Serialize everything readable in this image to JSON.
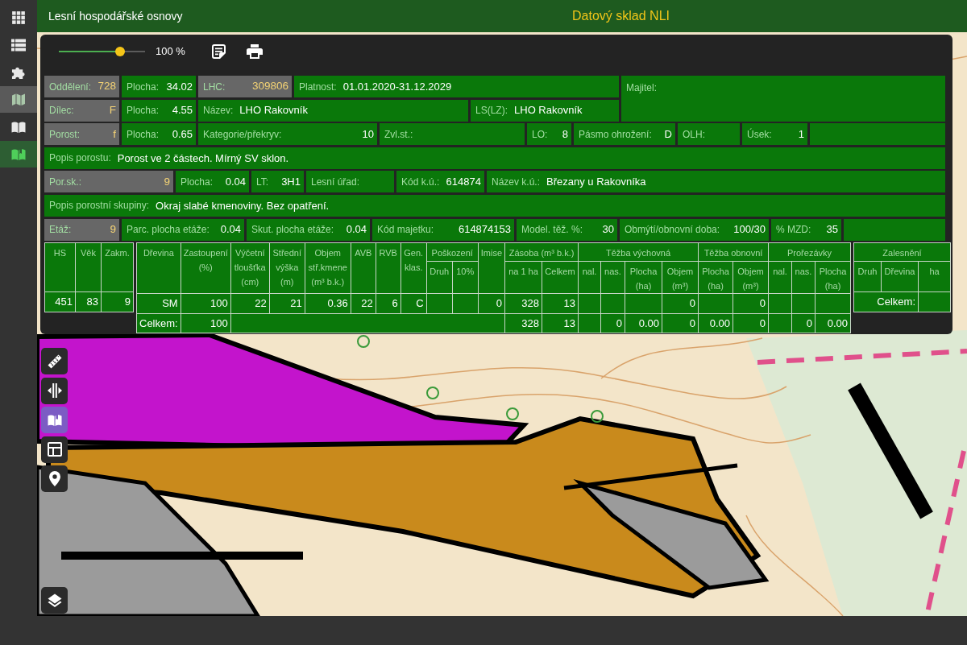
{
  "sidebar": {
    "items": [
      {
        "kind": "apps",
        "selected": false,
        "open": false
      },
      {
        "kind": "list",
        "selected": false,
        "open": false
      },
      {
        "kind": "puzzle",
        "selected": false,
        "open": false
      },
      {
        "kind": "map",
        "selected": false,
        "open": true
      },
      {
        "kind": "reader",
        "selected": false,
        "open": false
      },
      {
        "kind": "book",
        "selected": true,
        "open": false
      }
    ]
  },
  "header": {
    "title": "Lesní hospodářské osnovy",
    "app_name": "Datový sklad NLI"
  },
  "toolbar": {
    "zoom": {
      "level": 0.71,
      "reading": "100 %"
    },
    "buttons": [
      {
        "kind": "notes"
      },
      {
        "kind": "print"
      }
    ]
  },
  "info": {
    "top_lines": [
      {
        "fields": [
          {
            "kind": "key",
            "label": "Oddělení:",
            "value": "728"
          },
          {
            "kind": "number",
            "label": "Plocha:",
            "value": "34.02"
          },
          {
            "kind": "key",
            "label": "LHC:",
            "value": "309806"
          },
          {
            "kind": "text",
            "label": "Platnost:",
            "value": "01.01.2020-31.12.2029"
          }
        ]
      },
      {
        "fields": [
          {
            "kind": "key",
            "label": "Dílec:",
            "value": "F"
          },
          {
            "kind": "number",
            "label": "Plocha:",
            "value": "4.55"
          },
          {
            "kind": "text",
            "label": "Název:",
            "value": "LHO Rakovník"
          },
          {
            "kind": "text",
            "label": "LS(LZ):",
            "value": "LHO Rakovník"
          }
        ]
      }
    ],
    "owner": {
      "label": "Majitel:"
    },
    "lines": [
      {
        "fields": [
          {
            "kind": "key",
            "label": "Porost:",
            "value": "f"
          },
          {
            "kind": "number",
            "label": "Plocha:",
            "value": "0.65"
          },
          {
            "kind": "number",
            "label": "Kategorie/překryv:",
            "value": "10"
          },
          {
            "kind": "number",
            "label": "Zvl.st.:"
          },
          {
            "kind": "number",
            "label": "LO:",
            "value": "8"
          },
          {
            "kind": "number",
            "label": "Pásmo ohrožení:",
            "value": "D"
          },
          {
            "kind": "number",
            "label": "OLH:"
          },
          {
            "kind": "number",
            "label": "Úsek:",
            "value": "1"
          },
          {
            "kind": "blank"
          }
        ]
      },
      {
        "fields": [
          {
            "kind": "text",
            "label": "Popis porostu:",
            "value": "Porost ve 2 částech. Mírný SV sklon."
          }
        ]
      },
      {
        "fields": [
          {
            "kind": "key",
            "label": "Por.sk.:",
            "value": "9"
          },
          {
            "kind": "number",
            "label": "Plocha:",
            "value": "0.04"
          },
          {
            "kind": "number",
            "label": "LT:",
            "value": "3H1"
          },
          {
            "kind": "number",
            "label": "Lesní úřad:"
          },
          {
            "kind": "number",
            "label": "Kód k.ú.:",
            "value": "614874"
          },
          {
            "kind": "text",
            "label": "Název k.ú.:",
            "value": "Březany u Rakovníka"
          }
        ]
      },
      {
        "fields": [
          {
            "kind": "text",
            "label": "Popis porostní skupiny:",
            "value": "Okraj slabé kmenoviny. Bez opatření."
          }
        ]
      },
      {
        "fields": [
          {
            "kind": "key",
            "label": "Etáž:",
            "value": "9"
          },
          {
            "kind": "number",
            "label": "Parc. plocha etáže:",
            "value": "0.04"
          },
          {
            "kind": "number",
            "label": "Skut. plocha etáže:",
            "value": "0.04"
          },
          {
            "kind": "number",
            "label": "Kód majetku:",
            "value": "614874153"
          },
          {
            "kind": "number",
            "label": "Model. těž. %:",
            "value": "30"
          },
          {
            "kind": "number",
            "label": "Obmýtí/obnovní doba:",
            "value": "100/30"
          },
          {
            "kind": "number",
            "label": "% MZD:",
            "value": "35"
          },
          {
            "kind": "blank"
          }
        ]
      }
    ]
  },
  "stand_table": {
    "columns": [
      "HS",
      "Věk",
      "Zakm."
    ],
    "rows": [
      [
        "451",
        "83",
        "9"
      ]
    ]
  },
  "species_table": {
    "header_rows": [
      [
        {
          "label": "Dřevina",
          "rowspan": 2
        },
        {
          "label": "Zastoupení (%)",
          "rowspan": 2
        },
        {
          "label": "Výčetní tloušťka (cm)",
          "rowspan": 2
        },
        {
          "label": "Střední výška (m)",
          "rowspan": 2
        },
        {
          "label": "Objem stř.kmene (m³ b.k.)",
          "rowspan": 2
        },
        {
          "label": "AVB",
          "rowspan": 2
        },
        {
          "label": "RVB",
          "rowspan": 2
        },
        {
          "label": "Gen. klas.",
          "rowspan": 2
        },
        {
          "label": "Poškození",
          "colspan": 2
        },
        {
          "label": "Imise",
          "rowspan": 2
        },
        {
          "label": "Zásoba (m³ b.k.)",
          "colspan": 2
        },
        {
          "label": "Těžba výchovná",
          "colspan": 4
        },
        {
          "label": "Těžba obnovní",
          "colspan": 2
        },
        {
          "label": "Prořezávky",
          "colspan": 3
        }
      ],
      [
        {
          "label": "Druh"
        },
        {
          "label": "10%"
        },
        {
          "label": "na 1 ha"
        },
        {
          "label": "Celkem"
        },
        {
          "label": "nal."
        },
        {
          "label": "nas."
        },
        {
          "label": "Plocha (ha)"
        },
        {
          "label": "Objem (m³)"
        },
        {
          "label": "Plocha (ha)"
        },
        {
          "label": "Objem (m³)"
        },
        {
          "label": "nal."
        },
        {
          "label": "nas."
        },
        {
          "label": "Plocha (ha)"
        }
      ]
    ],
    "rows": [
      [
        "SM",
        "100",
        "22",
        "21",
        "0.36",
        "22",
        "6",
        "C",
        "",
        "",
        "0",
        "328",
        "13",
        "",
        "",
        "",
        "0",
        "",
        "0",
        "",
        "",
        ""
      ],
      [
        "Celkem:",
        "100",
        {
          "colspan": 9
        },
        "328",
        "13",
        "",
        "0",
        "0.00",
        "0",
        "0.00",
        "0",
        "",
        "0",
        "0.00"
      ]
    ]
  },
  "afforestation_table": {
    "header_rows": [
      [
        {
          "label": "Zalesnění",
          "colspan": 3
        }
      ],
      [
        {
          "label": "Druh"
        },
        {
          "label": "Dřevina"
        },
        {
          "label": "ha"
        }
      ]
    ],
    "rows": [
      [
        {
          "text": "Celkem:",
          "colspan": 2
        },
        ""
      ]
    ]
  },
  "map_tools": [
    {
      "kind": "ruler",
      "selected": false
    },
    {
      "kind": "split",
      "selected": false
    },
    {
      "kind": "book",
      "selected": true
    },
    {
      "kind": "layout",
      "selected": false
    },
    {
      "kind": "pin",
      "selected": false
    },
    {
      "kind": "layers",
      "selected": false
    }
  ]
}
